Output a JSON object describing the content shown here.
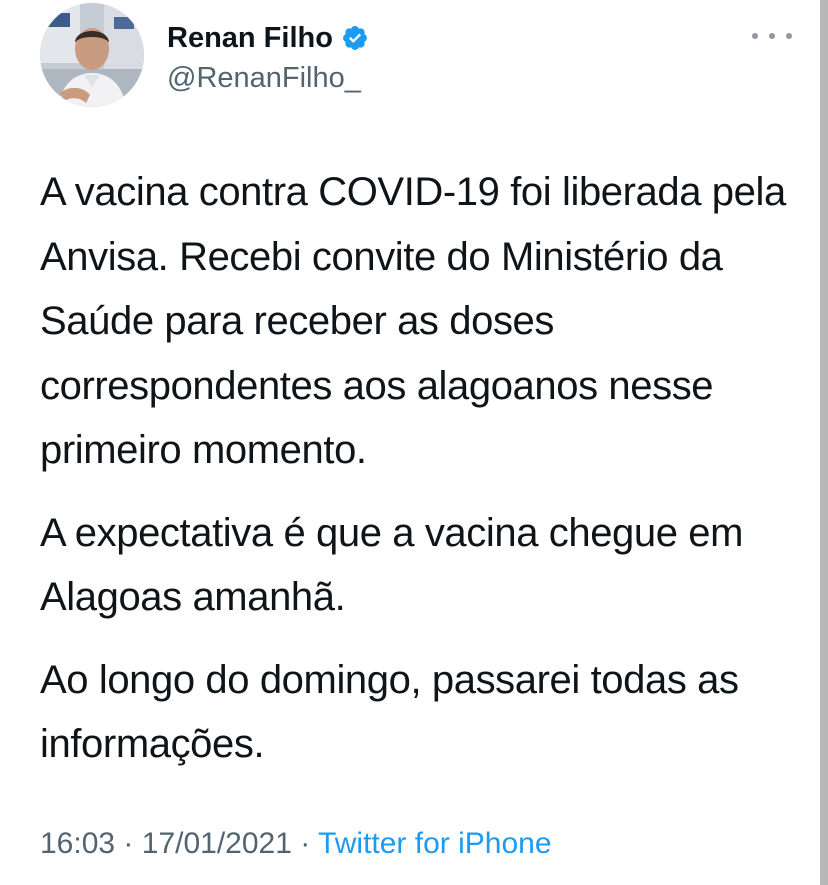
{
  "author": {
    "display_name": "Renan Filho",
    "handle": "@RenanFilho_",
    "verified": true
  },
  "tweet": {
    "paragraphs": [
      "A vacina contra COVID-19 foi liberada pela Anvisa. Recebi convite do Ministério da Saúde para receber as doses correspondentes aos alagoanos nesse primeiro momento.",
      "A expectativa é que a vacina chegue em Alagoas amanhã.",
      "Ao longo do domingo, passarei todas as informações."
    ],
    "time": "16:03",
    "date": "17/01/2021",
    "separator": "·",
    "source": "Twitter for iPhone"
  },
  "icons": {
    "verified": "verified-badge-icon",
    "more": "more-options-icon"
  },
  "colors": {
    "text": "#0f1419",
    "secondary": "#536471",
    "link": "#1d9bf0",
    "verified": "#1d9bf0"
  }
}
